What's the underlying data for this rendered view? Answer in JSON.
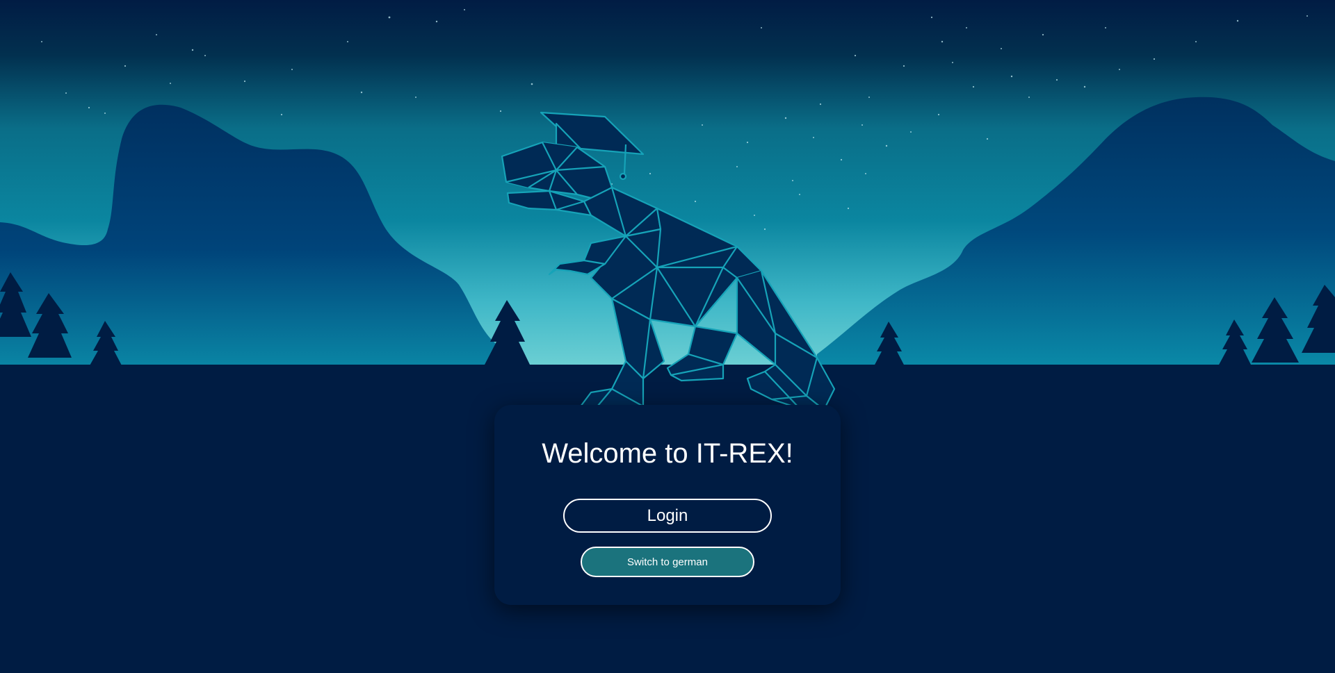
{
  "title": "Welcome to IT-REX!",
  "login_label": "Login",
  "language_switch_label": "Switch to german",
  "colors": {
    "background": "#001c43",
    "sky_top": "#011c44",
    "sky_horizon": "#6dd0d4",
    "mountains": "#002a55",
    "dino_outline": "#16a3b8",
    "switch_button": "#1b737d",
    "text": "#ffffff"
  },
  "icons": [
    "t-rex-constellation-logo",
    "graduation-cap-icon",
    "pine-tree-icon",
    "mountain-icon"
  ]
}
